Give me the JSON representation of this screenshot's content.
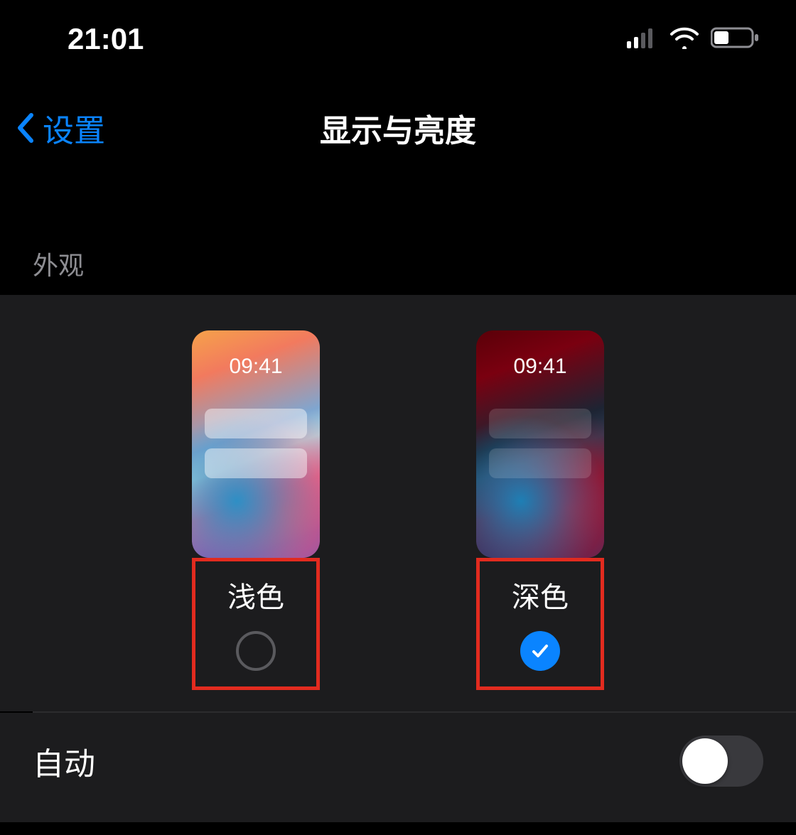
{
  "status": {
    "time": "21:01"
  },
  "nav": {
    "back_label": "设置",
    "title": "显示与亮度"
  },
  "appearance": {
    "section_header": "外观",
    "preview_time": "09:41",
    "light": {
      "label": "浅色",
      "selected": false
    },
    "dark": {
      "label": "深色",
      "selected": true
    }
  },
  "auto": {
    "label": "自动",
    "enabled": false
  },
  "colors": {
    "accent": "#0a84ff",
    "highlight_box": "#e22b1f"
  }
}
